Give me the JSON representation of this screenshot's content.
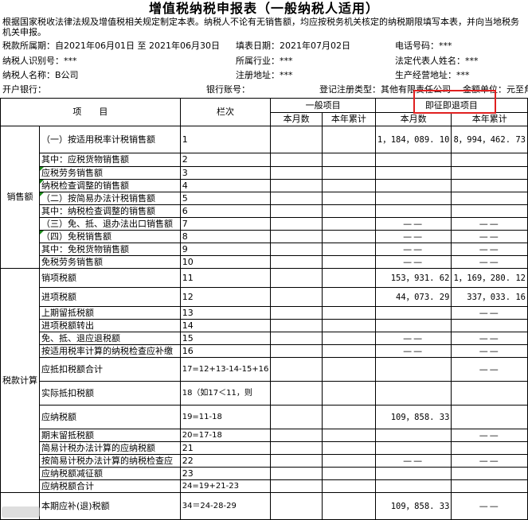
{
  "title": "增值税纳税申报表（一般纳税人适用）",
  "intro": "根据国家税收法律法规及增值税相关规定制定本表。纳税人不论有无销售额，均应按税务机关核定的纳税期限填写本表，并向当地税务机关申报。",
  "info": {
    "period_label": "税款所属期：",
    "period_value": "自2021年06月01日 至 2021年06月30日",
    "fill_date_label": "填表日期：",
    "fill_date_value": "2021年07月02日",
    "phone_label": "电话号码：",
    "phone_value": "***",
    "taxid_label": "纳税人识别号：",
    "taxid_value": "***",
    "industry_label": "所属行业：",
    "industry_value": "***",
    "rep_label": "法定代表人姓名：",
    "rep_value": "***",
    "name_label": "纳税人名称：",
    "name_value": "B公司",
    "regaddr_label": "注册地址：",
    "regaddr_value": "***",
    "bizaddr_label": "生产经营地址：",
    "bizaddr_value": "***",
    "bank_label": "开户银行：",
    "account_label": "银行账号：",
    "regtype_label": "登记注册类型：",
    "regtype_value": "其他有限责任公司",
    "unit_label": "金额单位：",
    "unit_value": "元至角分"
  },
  "table": {
    "header_item": "项　　目",
    "header_col": "栏次",
    "group_general": "一般项目",
    "group_refund": "即征即退项目",
    "sub_month": "本月数",
    "sub_ytd": "本年累计",
    "section_sales": "销售额",
    "section_tax": "税款计算",
    "rows": [
      {
        "item": "（一）按适用税率计税销售额",
        "col": "1",
        "v1": "",
        "v2": "",
        "v3": "1，184，089. 10",
        "v4": "8，994，462. 73"
      },
      {
        "item": "其中：应税货物销售额",
        "col": "2",
        "v1": "",
        "v2": "",
        "v3": "",
        "v4": ""
      },
      {
        "item": "应税劳务销售额",
        "col": "3",
        "v1": "",
        "v2": "",
        "v3": "",
        "v4": ""
      },
      {
        "item": "纳税检查调整的销售额",
        "col": "4",
        "v1": "",
        "v2": "",
        "v3": "",
        "v4": ""
      },
      {
        "item": "（二）按简易办法计税销售额",
        "col": "5",
        "v1": "",
        "v2": "",
        "v3": "",
        "v4": ""
      },
      {
        "item": "其中：纳税检查调整的销售额",
        "col": "6",
        "v1": "",
        "v2": "",
        "v3": "",
        "v4": ""
      },
      {
        "item": "（三）免、抵、退办法出口销售额",
        "col": "7",
        "v1": "",
        "v2": "",
        "v3": "——",
        "v4": "——"
      },
      {
        "item": "（四）免税销售额",
        "col": "8",
        "v1": "",
        "v2": "",
        "v3": "——",
        "v4": "——"
      },
      {
        "item": "其中：免税货物销售额",
        "col": "9",
        "v1": "",
        "v2": "",
        "v3": "——",
        "v4": "——"
      },
      {
        "item": "免税劳务销售额",
        "col": "10",
        "v1": "",
        "v2": "",
        "v3": "——",
        "v4": "——"
      },
      {
        "item": "销项税额",
        "col": "11",
        "v1": "",
        "v2": "",
        "v3": "153，931. 62",
        "v4": "1，169，280. 12"
      },
      {
        "item": "进项税额",
        "col": "12",
        "v1": "",
        "v2": "",
        "v3": "44，073. 29",
        "v4": "337，033. 16"
      },
      {
        "item": "上期留抵税额",
        "col": "13",
        "v1": "",
        "v2": "",
        "v3": "",
        "v4": "——"
      },
      {
        "item": "进项税额转出",
        "col": "14",
        "v1": "",
        "v2": "",
        "v3": "",
        "v4": ""
      },
      {
        "item": "免、抵、退应退税额",
        "col": "15",
        "v1": "",
        "v2": "",
        "v3": "——",
        "v4": "——"
      },
      {
        "item": "按适用税率计算的纳税检查应补缴",
        "col": "16",
        "v1": "",
        "v2": "",
        "v3": "——",
        "v4": "——"
      },
      {
        "item": "应抵扣税额合计",
        "col": "17=12+13-14-15+16",
        "v1": "",
        "v2": "",
        "v3": "",
        "v4": "——"
      },
      {
        "item": "实际抵扣税额",
        "col": "18（如17＜11，则",
        "v1": "",
        "v2": "",
        "v3": "",
        "v4": ""
      },
      {
        "item": "应纳税额",
        "col": "19=11-18",
        "v1": "",
        "v2": "",
        "v3": "109，858. 33",
        "v4": ""
      },
      {
        "item": "期末留抵税额",
        "col": "20=17-18",
        "v1": "",
        "v2": "",
        "v3": "",
        "v4": "——"
      },
      {
        "item": "简易计税办法计算的应纳税额",
        "col": "21",
        "v1": "",
        "v2": "",
        "v3": "",
        "v4": ""
      },
      {
        "item": "按简易计税办法计算的纳税检查应",
        "col": "22",
        "v1": "",
        "v2": "",
        "v3": "——",
        "v4": "——"
      },
      {
        "item": "应纳税额减征额",
        "col": "23",
        "v1": "",
        "v2": "",
        "v3": "",
        "v4": ""
      },
      {
        "item": "应纳税额合计",
        "col": "24=19+21-23",
        "v1": "",
        "v2": "",
        "v3": "",
        "v4": ""
      },
      {
        "item": "本期应补(退)税额",
        "col": "34＝24-28-29",
        "v1": "",
        "v2": "",
        "v3": "109，858. 33",
        "v4": "——"
      }
    ]
  },
  "colors": {
    "highlight_box": "#e02020",
    "marker": "#1a8a1a"
  }
}
